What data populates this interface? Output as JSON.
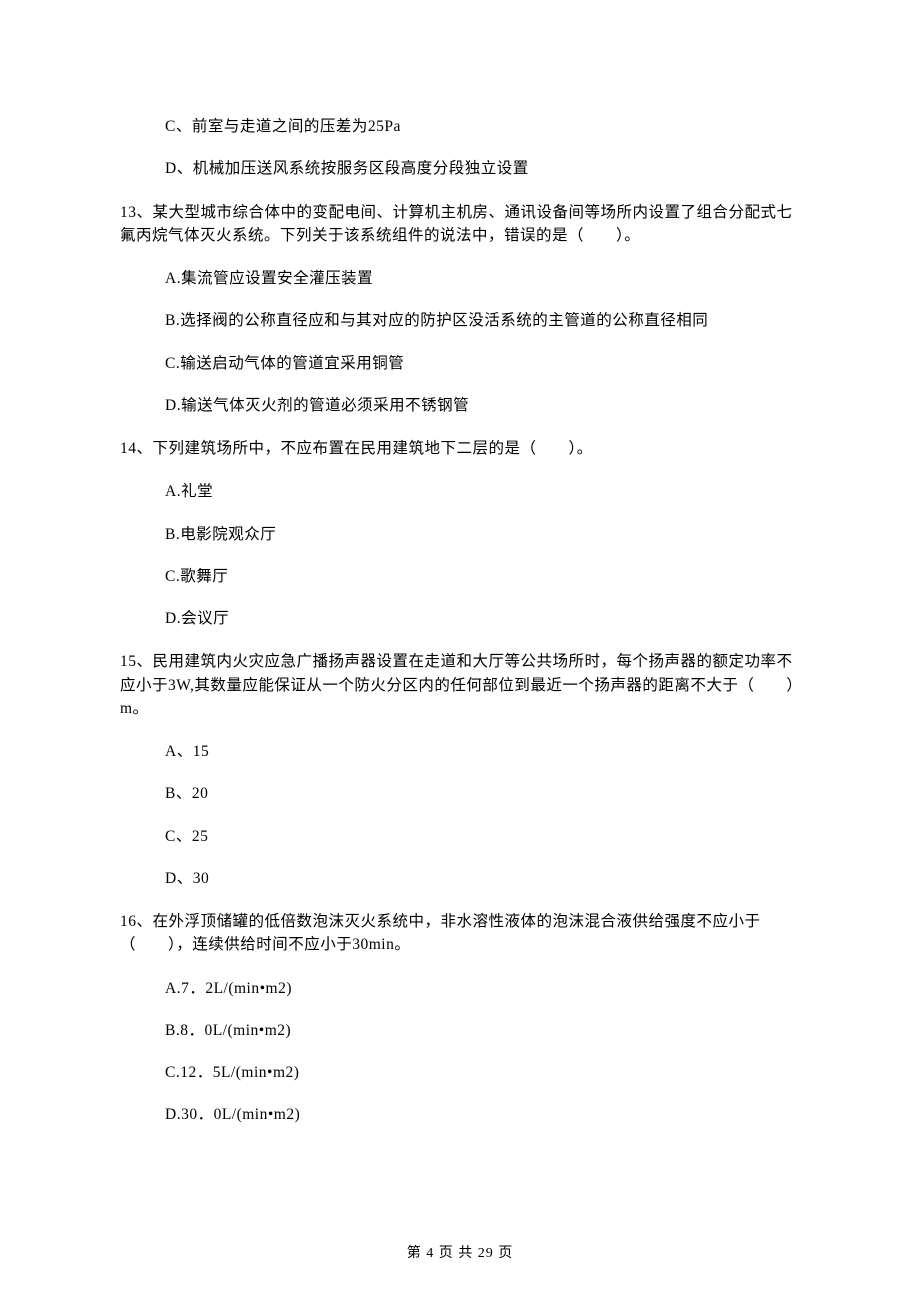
{
  "prev_tail": {
    "opt_c": "C、前室与走道之间的压差为25Pa",
    "opt_d": "D、机械加压送风系统按服务区段高度分段独立设置"
  },
  "q13": {
    "stem": "13、某大型城市综合体中的变配电间、计算机主机房、通讯设备间等场所内设置了组合分配式七氟丙烷气体灭火系统。下列关于该系统组件的说法中，错误的是（　　）。",
    "opt_a": "A.集流管应设置安全灌压装置",
    "opt_b": "B.选择阀的公称直径应和与其对应的防护区没活系统的主管道的公称直径相同",
    "opt_c": "C.输送启动气体的管道宜采用铜管",
    "opt_d": "D.输送气体灭火剂的管道必须采用不锈钢管"
  },
  "q14": {
    "stem": "14、下列建筑场所中，不应布置在民用建筑地下二层的是（　　）。",
    "opt_a": "A.礼堂",
    "opt_b": "B.电影院观众厅",
    "opt_c": "C.歌舞厅",
    "opt_d": "D.会议厅"
  },
  "q15": {
    "stem": "15、民用建筑内火灾应急广播扬声器设置在走道和大厅等公共场所时，每个扬声器的额定功率不应小于3W,其数量应能保证从一个防火分区内的任何部位到最近一个扬声器的距离不大于（　　）m。",
    "opt_a": "A、15",
    "opt_b": "B、20",
    "opt_c": "C、25",
    "opt_d": "D、30"
  },
  "q16": {
    "stem": "16、在外浮顶储罐的低倍数泡沫灭火系统中，非水溶性液体的泡沫混合液供给强度不应小于（　　），连续供给时间不应小于30min。",
    "opt_a": "A.7．2L/(min•m2)",
    "opt_b": "B.8．0L/(min•m2)",
    "opt_c": "C.12．5L/(min•m2)",
    "opt_d": "D.30．0L/(min•m2)"
  },
  "footer": "第 4 页 共 29 页"
}
